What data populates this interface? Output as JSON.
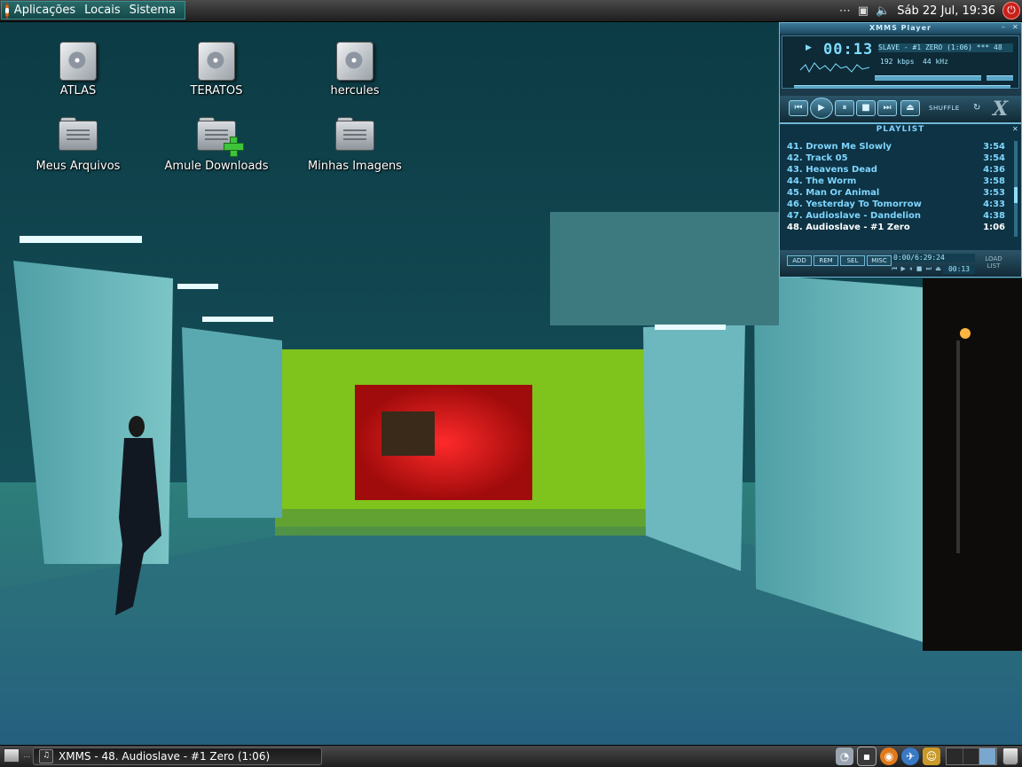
{
  "top_panel": {
    "menus": [
      "Aplicações",
      "Locais",
      "Sistema"
    ],
    "clock": "Sáb 22 Jul, 19:36"
  },
  "desktop_icons": [
    {
      "label": "ATLAS",
      "icon": "drive-icon"
    },
    {
      "label": "TERATOS",
      "icon": "drive-icon"
    },
    {
      "label": "hercules",
      "icon": "drive-icon"
    },
    {
      "label": "Meus Arquivos",
      "icon": "folder-icon"
    },
    {
      "label": "Amule Downloads",
      "icon": "folder-add-icon"
    },
    {
      "label": "Minhas Imagens",
      "icon": "folder-icon"
    }
  ],
  "xmms": {
    "title": "XMMS Player",
    "time": "00:13",
    "marquee": "SLAVE - #1 ZERO (1:06)  *** 48",
    "kbps": "192",
    "kbps_unit": "kbps",
    "khz": "44",
    "khz_unit": "kHz",
    "shuffle_label": "SHUFFLE",
    "playlist": {
      "title": "PLAYLIST",
      "items": [
        {
          "title": "41. Drown Me Slowly",
          "duration": "3:54"
        },
        {
          "title": "42. Track 05",
          "duration": "3:54"
        },
        {
          "title": "43. Heavens Dead",
          "duration": "4:36"
        },
        {
          "title": "44. The Worm",
          "duration": "3:58"
        },
        {
          "title": "45. Man Or Animal",
          "duration": "3:53"
        },
        {
          "title": "46. Yesterday To Tomorrow",
          "duration": "4:33"
        },
        {
          "title": "47. Audioslave - Dandelion",
          "duration": "4:38"
        },
        {
          "title": "48. Audioslave - #1 Zero",
          "duration": "1:06"
        }
      ],
      "current_index": 7,
      "buttons": [
        "ADD",
        "REM",
        "SEL",
        "MISC"
      ],
      "info": "0:00/6:29:24",
      "mini_time": "00:13",
      "load_list": "LOAD LIST"
    }
  },
  "taskbar": {
    "window_title": "XMMS - 48. Audioslave - #1 Zero (1:06)"
  },
  "colors": {
    "panel": "#2a2a2a",
    "xmms_accent": "#6fb7d6",
    "playlist_text": "#7fd6ff"
  }
}
